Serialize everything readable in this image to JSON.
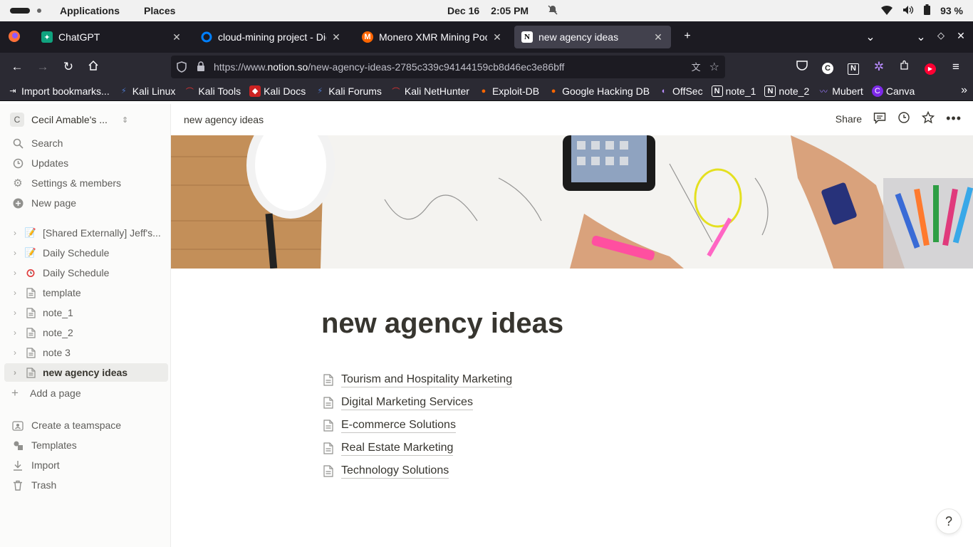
{
  "system": {
    "menus": [
      "Applications",
      "Places"
    ],
    "date": "Dec 16",
    "time": "2:05 PM",
    "battery": "93 %"
  },
  "browser": {
    "tabs": [
      {
        "title": "ChatGPT",
        "icon": "chatgpt-icon"
      },
      {
        "title": "cloud-mining project - Dig",
        "icon": "digitalocean-icon"
      },
      {
        "title": "Monero XMR Mining Pool",
        "icon": "monero-icon"
      },
      {
        "title": "new agency ideas",
        "icon": "notion-icon",
        "active": true
      }
    ],
    "url_prefix": "https://www.",
    "url_host": "notion.so",
    "url_path": "/new-agency-ideas-2785c339c94144159cb8d46ec3e86bff",
    "bookmarks": [
      {
        "label": "Import bookmarks...",
        "icon": "import-icon"
      },
      {
        "label": "Kali Linux",
        "icon": "kali-icon"
      },
      {
        "label": "Kali Tools",
        "icon": "kali-tools-icon"
      },
      {
        "label": "Kali Docs",
        "icon": "kali-docs-icon"
      },
      {
        "label": "Kali Forums",
        "icon": "kali-forums-icon"
      },
      {
        "label": "Kali NetHunter",
        "icon": "nethunter-icon"
      },
      {
        "label": "Exploit-DB",
        "icon": "exploitdb-icon"
      },
      {
        "label": "Google Hacking DB",
        "icon": "ghdb-icon"
      },
      {
        "label": "OffSec",
        "icon": "offsec-icon"
      },
      {
        "label": "note_1",
        "icon": "notion-icon"
      },
      {
        "label": "note_2",
        "icon": "notion-icon"
      },
      {
        "label": "Mubert",
        "icon": "mubert-icon"
      },
      {
        "label": "Canva",
        "icon": "canva-icon"
      }
    ]
  },
  "sidebar": {
    "workspace_initial": "C",
    "workspace": "Cecil Amable's ...",
    "nav": [
      "Search",
      "Updates",
      "Settings & members",
      "New page"
    ],
    "pages": [
      {
        "label": "[Shared Externally] Jeff's...",
        "icon": "memo-icon"
      },
      {
        "label": "Daily Schedule",
        "icon": "memo-icon"
      },
      {
        "label": "Daily Schedule",
        "icon": "alarm-clock-icon"
      },
      {
        "label": "template",
        "icon": "page-icon"
      },
      {
        "label": "note_1",
        "icon": "page-icon"
      },
      {
        "label": "note_2",
        "icon": "page-icon"
      },
      {
        "label": "note 3",
        "icon": "page-icon"
      },
      {
        "label": "new agency ideas",
        "icon": "page-icon",
        "active": true
      }
    ],
    "add_page": "Add a page",
    "footer": [
      "Create a teamspace",
      "Templates",
      "Import",
      "Trash"
    ]
  },
  "page": {
    "breadcrumb": "new agency ideas",
    "share": "Share",
    "title": "new agency ideas",
    "subpages": [
      "Tourism and Hospitality Marketing",
      "Digital Marketing Services",
      "E-commerce Solutions",
      "Real Estate Marketing",
      "Technology Solutions"
    ],
    "help": "?"
  },
  "colors": {
    "tabbar_bg": "#1c1b22",
    "toolbar_bg": "#2b2a33",
    "sidebar_bg": "#fbfbfa",
    "text": "#37352f"
  }
}
